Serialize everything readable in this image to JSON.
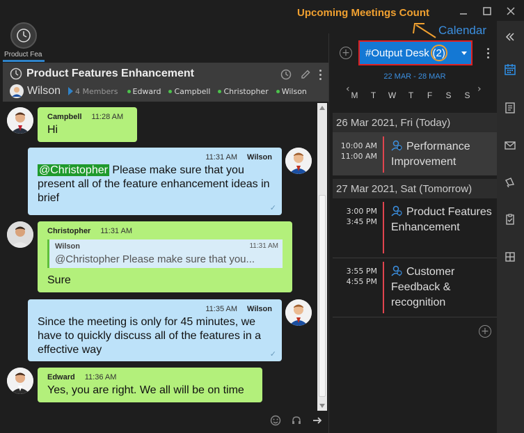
{
  "annotations": {
    "upcoming_label": "Upcoming Meetings Count",
    "calendar_label": "Calendar"
  },
  "app_tab": {
    "label": "Product Fea"
  },
  "chat": {
    "title": "Product Features Enhancement",
    "owner": "Wilson",
    "members_count": "4 Members",
    "members": [
      "Edward",
      "Campbell",
      "Christopher",
      "Wilson"
    ]
  },
  "messages": [
    {
      "sender": "Campbell",
      "time": "11:28 AM",
      "text": "Hi",
      "direction": "in"
    },
    {
      "sender": "Wilson",
      "time": "11:31 AM",
      "mention": "@Christopher",
      "text": " Please make sure that you present all of the feature enhancement ideas in brief",
      "direction": "out"
    },
    {
      "sender": "Christopher",
      "time": "11:31 AM",
      "quote_sender": "Wilson",
      "quote_time": "11:31 AM",
      "quote_text": "@Christopher Please make sure that you...",
      "text": "Sure",
      "direction": "in"
    },
    {
      "sender": "Wilson",
      "time": "11:35 AM",
      "text": "Since the meeting is only for 45 minutes, we have to quickly discuss all of the features in a effective way",
      "direction": "out"
    },
    {
      "sender": "Edward",
      "time": "11:36 AM",
      "text": "Yes, you are right. We all will be on time",
      "direction": "in"
    }
  ],
  "calendar": {
    "selected": "#Output Desk",
    "count": "(2)",
    "range": "22 MAR - 28 MAR",
    "days": [
      "M",
      "T",
      "W",
      "T",
      "F",
      "S",
      "S"
    ],
    "day1": "26 Mar 2021, Fri (Today)",
    "day2": "27 Mar 2021, Sat (Tomorrow)",
    "events": [
      {
        "start": "10:00 AM",
        "end": "11:00 AM",
        "title": "Performance Improvement"
      },
      {
        "start": "3:00 PM",
        "end": "3:45 PM",
        "title": "Product Features Enhancement"
      },
      {
        "start": "3:55 PM",
        "end": "4:55 PM",
        "title": "Customer Feedback & recognition"
      }
    ]
  },
  "colors": {
    "accent": "#1478d4",
    "incoming_bubble": "#b3f07b",
    "outgoing_bubble": "#bde2f9",
    "event_bar": "#e0444e",
    "annotation": "#f0a030"
  }
}
